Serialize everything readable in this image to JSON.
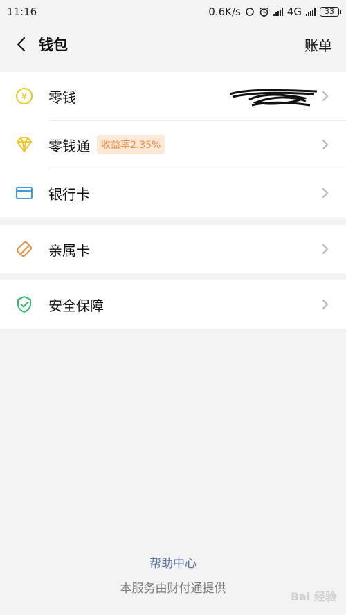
{
  "status_bar": {
    "time": "11:16",
    "speed": "0.6K/s",
    "network": "4G",
    "battery": "33"
  },
  "nav": {
    "title": "钱包",
    "action": "账单"
  },
  "groups": [
    {
      "items": [
        {
          "label": "零钱",
          "icon": "yuan-coin-icon",
          "color": "#f2c318"
        },
        {
          "label": "零钱通",
          "icon": "diamond-icon",
          "color": "#f2c318",
          "badge": "收益率2.35%"
        },
        {
          "label": "银行卡",
          "icon": "bank-card-icon",
          "color": "#3a9be8"
        }
      ]
    },
    {
      "items": [
        {
          "label": "亲属卡",
          "icon": "family-card-icon",
          "color": "#f08a3c"
        }
      ]
    },
    {
      "items": [
        {
          "label": "安全保障",
          "icon": "shield-check-icon",
          "color": "#2bbd6b"
        }
      ]
    }
  ],
  "footer": {
    "help_link": "帮助中心",
    "provider_text": "本服务由财付通提供"
  },
  "watermark": "Bai 经验"
}
